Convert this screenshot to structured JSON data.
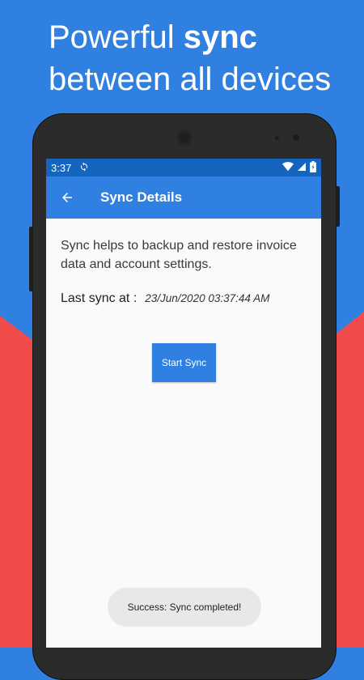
{
  "headline": {
    "prefix": "Powerful ",
    "bold": "sync",
    "line2": "between all devices"
  },
  "colors": {
    "primary": "#2f80e0",
    "status_bar": "#1565c0",
    "accent_red": "#f24b4b"
  },
  "statusbar": {
    "time": "3:37",
    "icons": [
      "sync-icon",
      "wifi-icon",
      "cellular-icon",
      "battery-icon"
    ]
  },
  "appbar": {
    "back_icon": "arrow-back-icon",
    "title": "Sync Details"
  },
  "content": {
    "description": "Sync helps to backup and restore invoice data and account settings.",
    "last_sync_label": "Last sync at :",
    "last_sync_value": "23/Jun/2020 03:37:44 AM"
  },
  "button": {
    "label": "Start Sync"
  },
  "toast": {
    "message": "Success: Sync completed!"
  }
}
